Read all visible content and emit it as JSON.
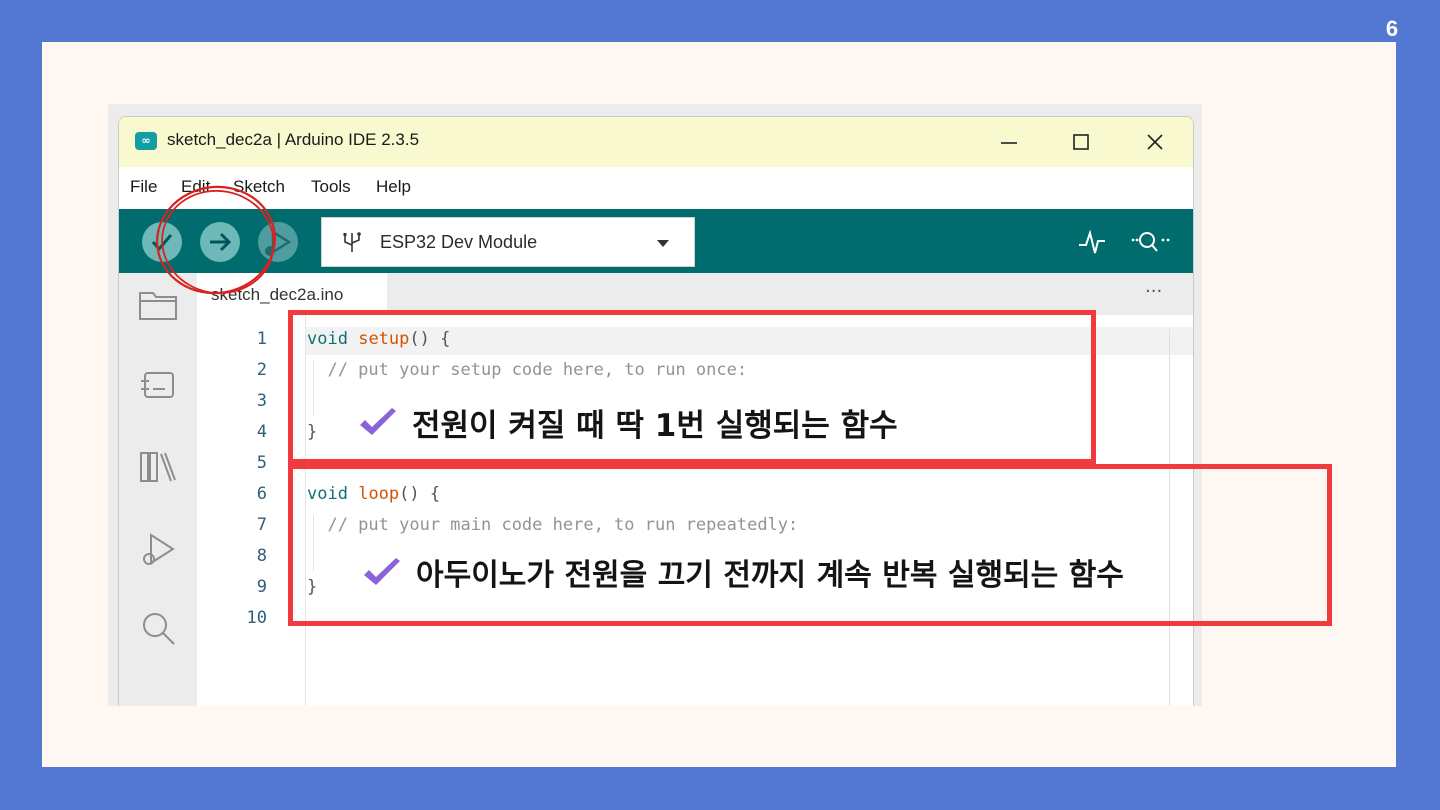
{
  "page_number": "6",
  "window": {
    "title": "sketch_dec2a | Arduino IDE 2.3.5",
    "controls": [
      "minimize-icon",
      "maximize-icon",
      "close-icon"
    ]
  },
  "menu": [
    "File",
    "Edit",
    "Sketch",
    "Tools",
    "Help"
  ],
  "toolbar": {
    "buttons": [
      "verify-icon",
      "upload-icon",
      "debug-icon"
    ],
    "board": "ESP32 Dev Module",
    "right_icons": [
      "serial-plotter-icon",
      "serial-monitor-icon"
    ]
  },
  "sidebar_icons": [
    "folder-icon",
    "boards-manager-icon",
    "library-icon",
    "debug-icon",
    "search-icon"
  ],
  "tab": {
    "filename": "sketch_dec2a.ino",
    "more": "···"
  },
  "code_lines": [
    {
      "num": "1",
      "kw": "void",
      "fn": "setup",
      "rest": "() {"
    },
    {
      "num": "2",
      "comment": "  // put your setup code here, to run once:"
    },
    {
      "num": "3",
      "text": ""
    },
    {
      "num": "4",
      "text": "}"
    },
    {
      "num": "5",
      "text": ""
    },
    {
      "num": "6",
      "kw": "void",
      "fn": "loop",
      "rest": "() {"
    },
    {
      "num": "7",
      "comment": "  // put your main code here, to run repeatedly:"
    },
    {
      "num": "8",
      "text": ""
    },
    {
      "num": "9",
      "text": "}"
    },
    {
      "num": "10",
      "text": ""
    }
  ],
  "annotations": {
    "setup": "전원이 켜질 때 딱 1번 실행되는 함수",
    "loop": "아두이노가 전원을 끄기 전까지 계속 반복 실행되는 함수"
  },
  "colors": {
    "background": "#5278d2",
    "titlebar": "#f8f9cf",
    "toolbar": "#006c6e",
    "highlight_box": "#f13a3e",
    "check": "#8b63d8"
  }
}
